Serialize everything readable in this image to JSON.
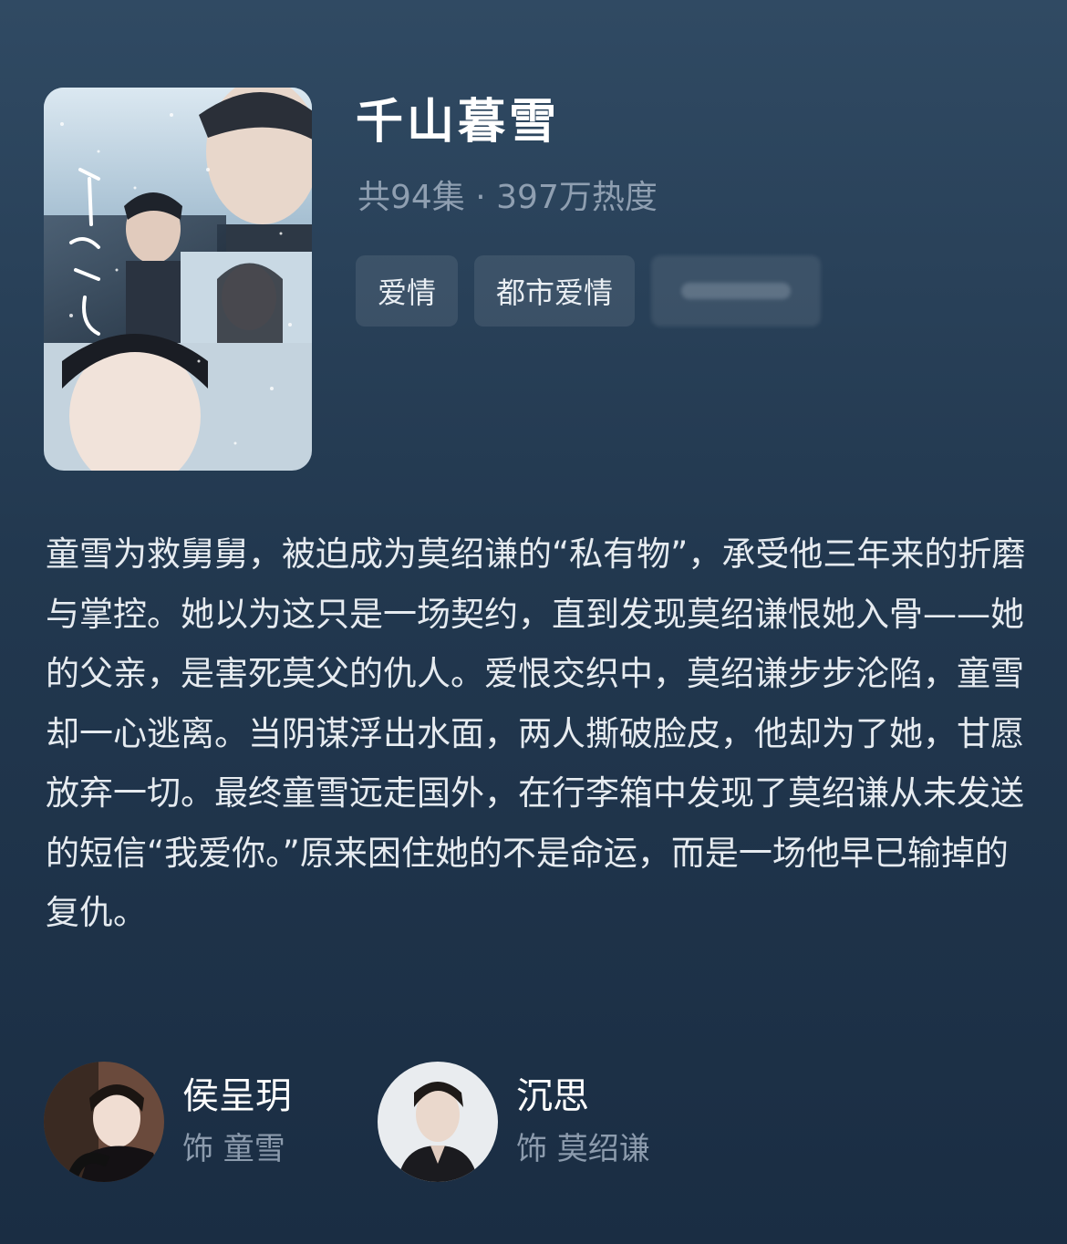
{
  "drama": {
    "title": "千山暮雪",
    "meta": "共94集 · 397万热度",
    "poster_alt": "poster-image",
    "tags": [
      "爱情",
      "都市爱情"
    ],
    "synopsis": "童雪为救舅舅，被迫成为莫绍谦的“私有物”，承受他三年来的折磨与掌控。她以为这只是一场契约，直到发现莫绍谦恨她入骨——她的父亲，是害死莫父的仇人。爱恨交织中，莫绍谦步步沦陷，童雪却一心逃离。当阴谋浮出水面，两人撕破脸皮，他却为了她，甘愿放弃一切。最终童雪远走国外，在行李箱中发现了莫绍谦从未发送的短信“我爱你。”原来困住她的不是命运，而是一场他早已输掉的复仇。"
  },
  "cast": [
    {
      "name": "侯呈玥",
      "role": "饰 童雪"
    },
    {
      "name": "沉思",
      "role": "饰 莫绍谦"
    }
  ]
}
